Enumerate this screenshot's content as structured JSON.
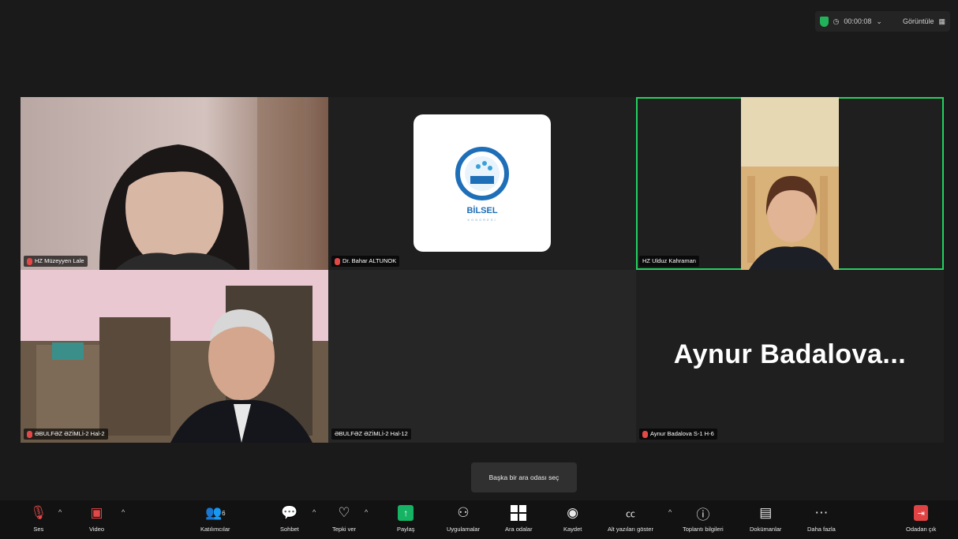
{
  "top_info": {
    "timer": "00:00:08",
    "view_label": "Görüntüle"
  },
  "tiles": [
    {
      "name": "HZ Müzeyyen Lale",
      "muted": true
    },
    {
      "name": "Dr. Bahar ALTUNOK",
      "muted": true,
      "logo_text": "BİLSEL",
      "logo_sub": "KONGRESİ"
    },
    {
      "name": "HZ Ulduz Kahraman",
      "muted": false,
      "active": true
    },
    {
      "name": "ƏBULFƏZ ƏZİMLİ-2 Hal-2",
      "muted": true
    },
    {
      "name": "ƏBULFƏZ ƏZİMLİ-2 Hal-12",
      "muted": false
    },
    {
      "name": "Aynur Badalova S-1 H-6",
      "muted": true,
      "display_name": "Aynur  Badalova..."
    }
  ],
  "tooltip": "Başka bir ara odası seç",
  "toolbar": {
    "audio": "Ses",
    "video": "Video",
    "participants": "Katılımcılar",
    "participants_count": "6",
    "chat": "Sohbet",
    "react": "Tepki ver",
    "share": "Paylaş",
    "apps": "Uygulamalar",
    "breakout": "Ara odalar",
    "record": "Kaydet",
    "captions": "Alt yazıları göster",
    "meeting_info": "Toplantı bilgileri",
    "docs": "Dokümanlar",
    "more": "Daha fazla",
    "leave": "Odadan çık"
  },
  "colors": {
    "active_border": "#23d160",
    "share_green": "#16b364",
    "muted_red": "#e34848"
  }
}
